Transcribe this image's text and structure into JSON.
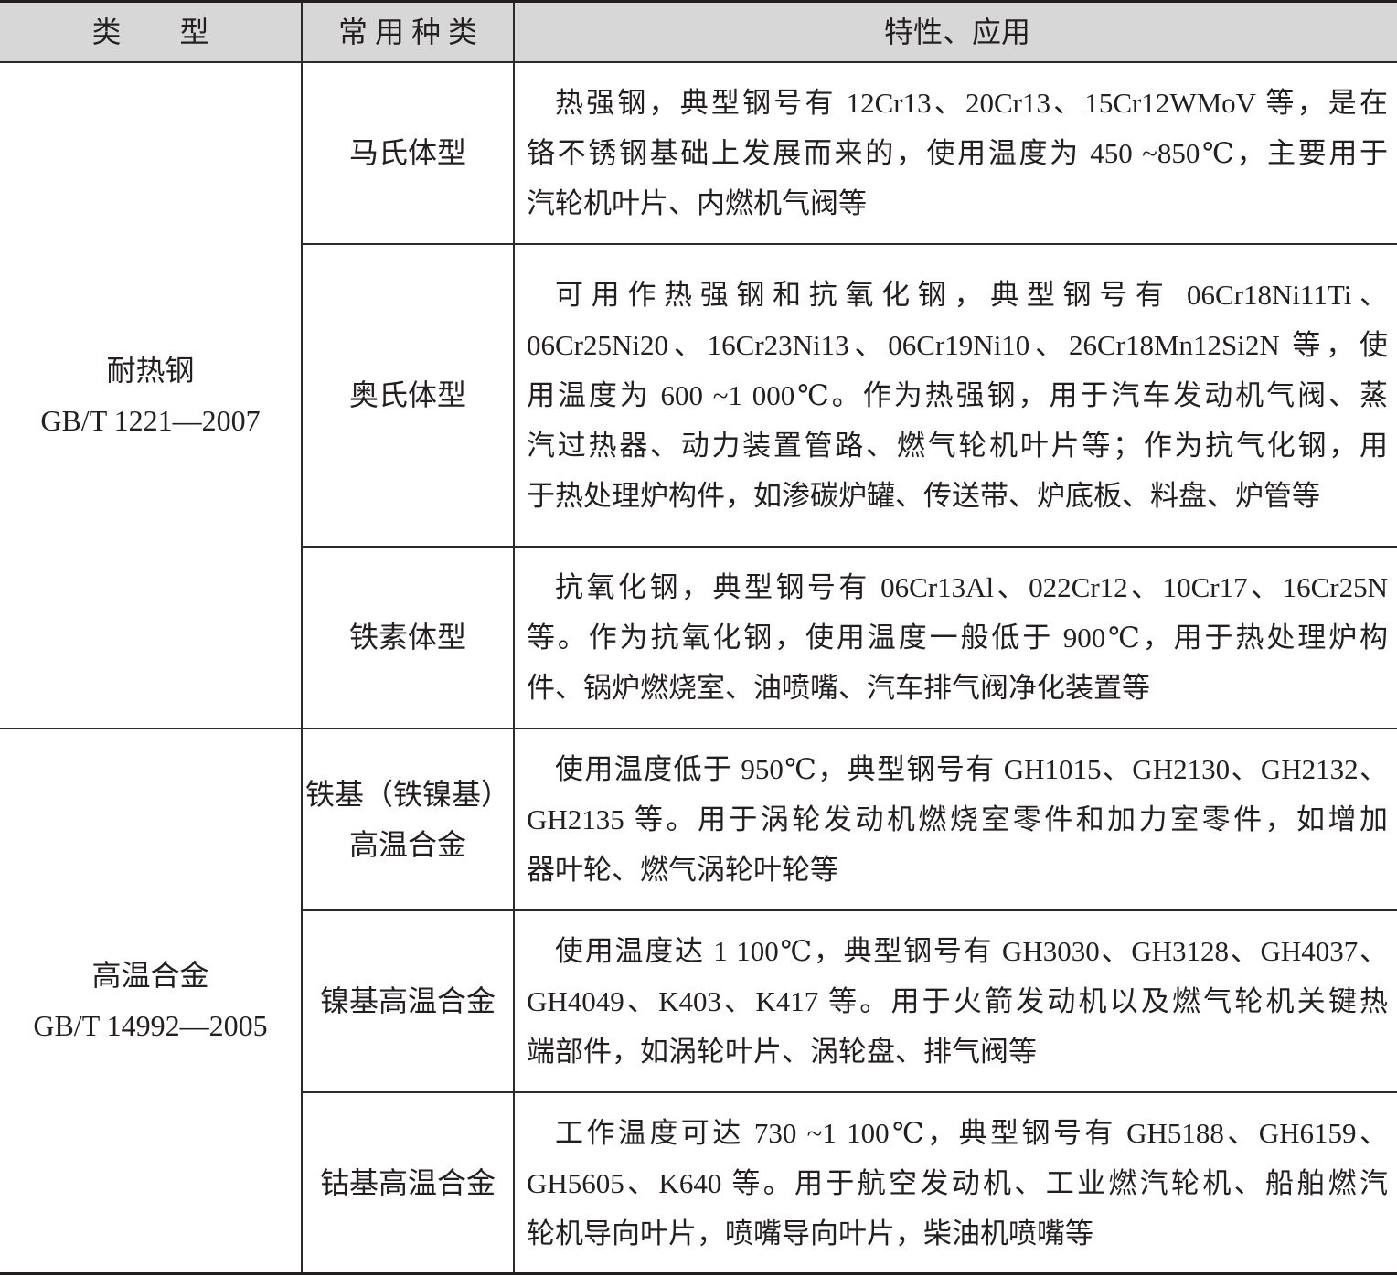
{
  "header": {
    "type": "类　　型",
    "variety": "常 用 种 类",
    "properties": "特性、应用"
  },
  "groups": [
    {
      "name": "耐热钢",
      "standard": "GB/T 1221—2007"
    },
    {
      "name": "高温合金",
      "standard": "GB/T 14992—2005"
    }
  ],
  "rows": [
    {
      "variety": [
        "马氏体型"
      ],
      "properties": [
        "热强钢，典型钢号有 12Cr13、20Cr13、15Cr12WMoV 等，是在",
        "铬不锈钢基础上发展而来的，使用温度为 450 ~850℃，主要用于",
        "汽轮机叶片、内燃机气阀等"
      ]
    },
    {
      "variety": [
        "奥氏体型"
      ],
      "properties": [
        "可用作热强钢和抗氧化钢，典型钢号有 06Cr18Ni11Ti、",
        "06Cr25Ni20、16Cr23Ni13、06Cr19Ni10、26Cr18Mn12Si2N 等，使",
        "用温度为 600 ~1 000℃。作为热强钢，用于汽车发动机气阀、蒸",
        "汽过热器、动力装置管路、燃气轮机叶片等；作为抗气化钢，用",
        "于热处理炉构件，如渗碳炉罐、传送带、炉底板、料盘、炉管等"
      ]
    },
    {
      "variety": [
        "铁素体型"
      ],
      "properties": [
        "抗氧化钢，典型钢号有 06Cr13Al、022Cr12、10Cr17、16Cr25N",
        "等。作为抗氧化钢，使用温度一般低于 900℃，用于热处理炉构",
        "件、锅炉燃烧室、油喷嘴、汽车排气阀净化装置等"
      ]
    },
    {
      "variety": [
        "铁基（铁镍基）",
        "高温合金"
      ],
      "properties": [
        "使用温度低于 950℃，典型钢号有 GH1015、GH2130、GH2132、",
        "GH2135 等。用于涡轮发动机燃烧室零件和加力室零件，如增加",
        "器叶轮、燃气涡轮叶轮等"
      ]
    },
    {
      "variety": [
        "镍基高温合金"
      ],
      "properties": [
        "使用温度达 1 100℃，典型钢号有 GH3030、GH3128、GH4037、",
        "GH4049、K403、K417 等。用于火箭发动机以及燃气轮机关键热",
        "端部件，如涡轮叶片、涡轮盘、排气阀等"
      ]
    },
    {
      "variety": [
        "钴基高温合金"
      ],
      "properties": [
        "工作温度可达 730 ~1 100℃，典型钢号有 GH5188、GH6159、",
        "GH5605、K640 等。用于航空发动机、工业燃汽轮机、船舶燃汽",
        "轮机导向叶片，喷嘴导向叶片，柴油机喷嘴等"
      ]
    }
  ]
}
